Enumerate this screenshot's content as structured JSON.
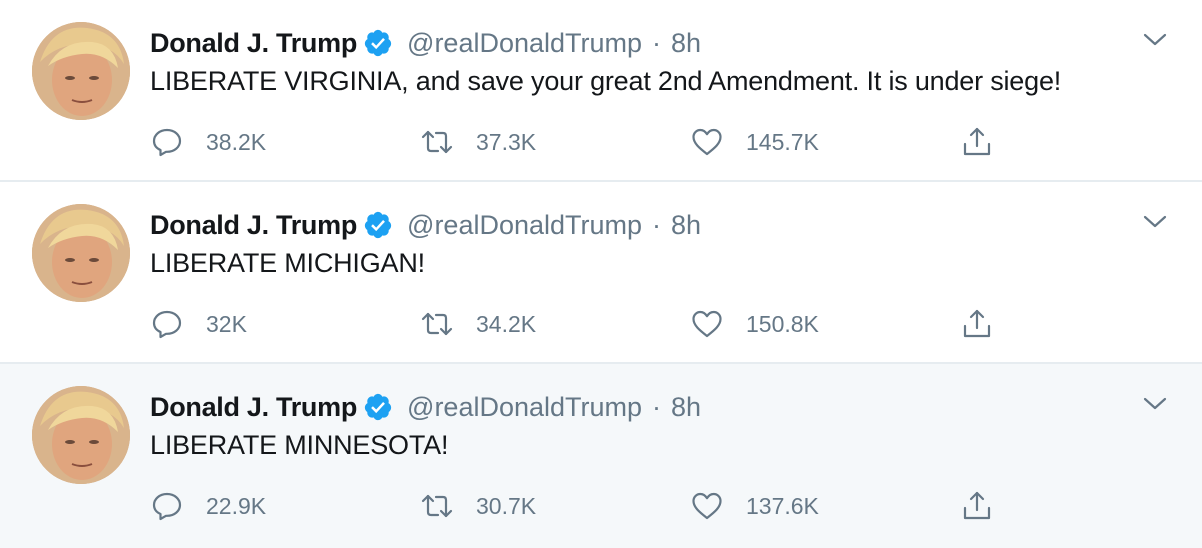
{
  "tweets": [
    {
      "name": "Donald J. Trump",
      "handle": "@realDonaldTrump",
      "separator": "·",
      "time": "8h",
      "text": "LIBERATE VIRGINIA, and save your great 2nd Amendment. It is under siege!",
      "replies": "38.2K",
      "retweets": "37.3K",
      "likes": "145.7K"
    },
    {
      "name": "Donald J. Trump",
      "handle": "@realDonaldTrump",
      "separator": "·",
      "time": "8h",
      "text": "LIBERATE MICHIGAN!",
      "replies": "32K",
      "retweets": "34.2K",
      "likes": "150.8K"
    },
    {
      "name": "Donald J. Trump",
      "handle": "@realDonaldTrump",
      "separator": "·",
      "time": "8h",
      "text": "LIBERATE MINNESOTA!",
      "replies": "22.9K",
      "retweets": "30.7K",
      "likes": "137.6K"
    }
  ],
  "icons": {
    "verified": "verified-badge-icon",
    "caret": "chevron-down-icon",
    "reply": "reply-icon",
    "retweet": "retweet-icon",
    "like": "heart-icon",
    "share": "share-icon"
  },
  "colors": {
    "verified": "#1da1f2",
    "icon_gray": "#657786",
    "hover_bg": "#f5f8fa",
    "divider": "#e6ecf0"
  }
}
